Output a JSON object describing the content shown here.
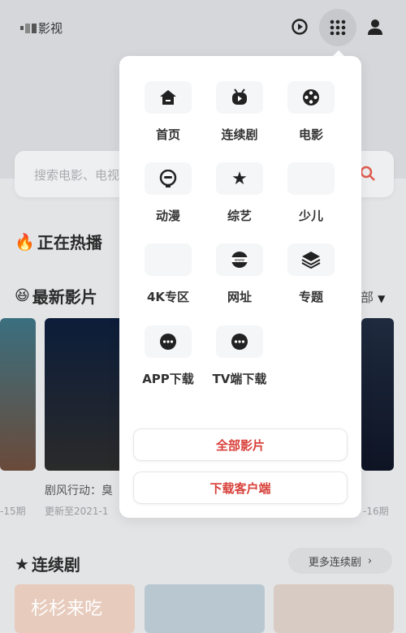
{
  "header": {
    "logo_text": "影视",
    "icons": [
      "history-play-icon",
      "grid-menu-icon",
      "user-icon"
    ]
  },
  "search": {
    "placeholder": "搜索电影、电视"
  },
  "sections": {
    "hot": "正在热播",
    "latest": "最新影片",
    "latest_filter": "部",
    "series": "连续剧",
    "more_series": "更多连续剧"
  },
  "latest": {
    "items": [
      {
        "subtitle": "-15期"
      },
      {
        "title": "剧风行动：臭",
        "subtitle": "更新至2021-1"
      },
      {
        "subtitle": "-16期"
      }
    ]
  },
  "series_posters": [
    {
      "title": "杉杉来吃"
    }
  ],
  "menu": {
    "items": [
      {
        "label": "首页",
        "icon": "home-icon"
      },
      {
        "label": "连续剧",
        "icon": "tv-play-icon"
      },
      {
        "label": "电影",
        "icon": "film-reel-icon"
      },
      {
        "label": "动漫",
        "icon": "anime-face-icon"
      },
      {
        "label": "综艺",
        "icon": "star-icon"
      },
      {
        "label": "少儿",
        "icon": ""
      },
      {
        "label": "4K专区",
        "icon": ""
      },
      {
        "label": "网址",
        "icon": "www-icon"
      },
      {
        "label": "专题",
        "icon": "layers-icon"
      },
      {
        "label": "APP下载",
        "icon": "more-dots-icon"
      },
      {
        "label": "TV端下载",
        "icon": "more-dots-icon"
      }
    ],
    "all_movies": "全部影片",
    "download_client": "下载客户端"
  },
  "colors": {
    "accent": "#d8403a"
  }
}
